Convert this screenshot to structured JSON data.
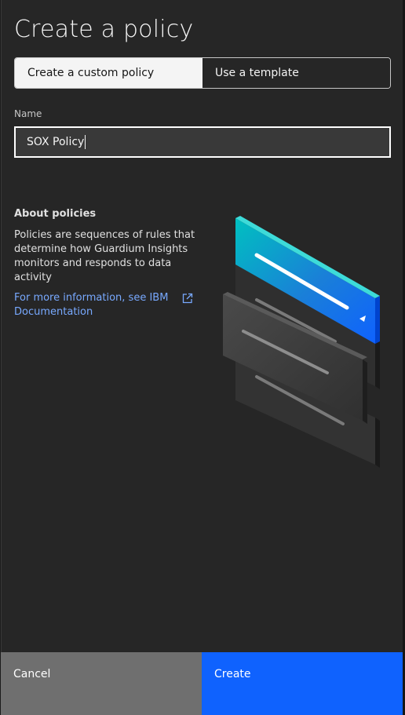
{
  "modal": {
    "title": "Create a policy"
  },
  "tabs": [
    {
      "label": "Create a custom policy",
      "selected": true
    },
    {
      "label": "Use a template",
      "selected": false
    }
  ],
  "name_field": {
    "label": "Name",
    "value": "SOX Policy"
  },
  "about": {
    "heading": "About policies",
    "body": "Policies are sequences of rules that determine how Guardium Insights monitors and responds to data activity",
    "link_text": "For more information, see IBM Documentation",
    "link_icon": "launch-icon"
  },
  "footer": {
    "cancel_label": "Cancel",
    "create_label": "Create"
  },
  "colors": {
    "background": "#262626",
    "primary_button": "#0f62fe",
    "secondary_button": "#6f6f6f",
    "link": "#78a9ff",
    "illustration_accent": "#00b2c8"
  }
}
